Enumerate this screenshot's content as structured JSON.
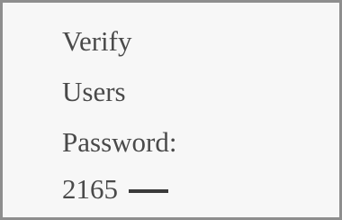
{
  "screen": {
    "line1": "Verify",
    "line2": "Users",
    "line3": "Password:",
    "password_value": "2165"
  }
}
